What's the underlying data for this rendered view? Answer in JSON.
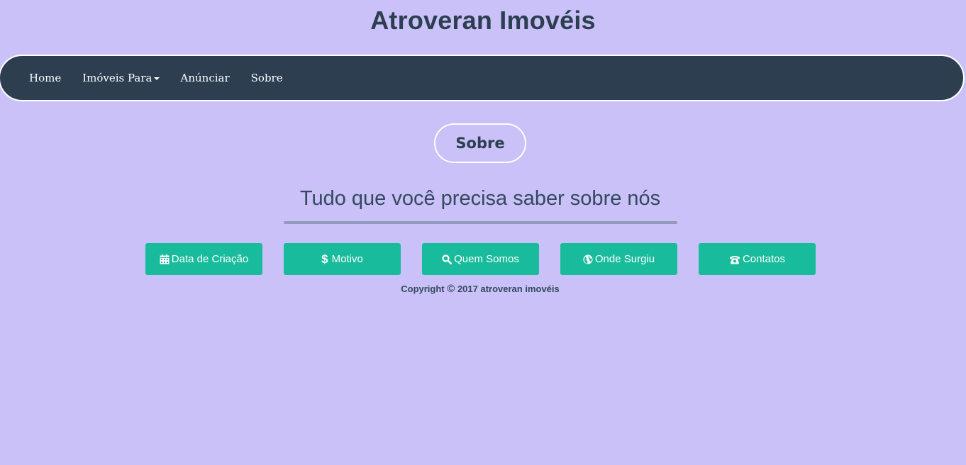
{
  "site": {
    "title": "Atroveran Imovéis"
  },
  "nav": {
    "items": [
      {
        "label": "Home"
      },
      {
        "label": "Imóveis Para"
      },
      {
        "label": "Anúnciar"
      },
      {
        "label": "Sobre"
      }
    ]
  },
  "section": {
    "title": "Sobre",
    "tagline": "Tudo que você precisa saber sobre nós"
  },
  "buttons": [
    {
      "label": "Data de Criação",
      "icon": "calendar-icon"
    },
    {
      "label": "Motivo",
      "icon": "dollar-icon"
    },
    {
      "label": "Quem Somos",
      "icon": "search-icon"
    },
    {
      "label": "Onde Surgiu",
      "icon": "globe-icon"
    },
    {
      "label": "Contatos",
      "icon": "phone-icon"
    }
  ],
  "footer": {
    "copyright_prefix": "Copyright",
    "copyright_symbol": "©",
    "copyright_suffix": "2017 atroveran imovéis"
  },
  "colors": {
    "background": "#c9c1f8",
    "navbar": "#2c3e50",
    "button": "#18bc9c",
    "text": "#2c3e50"
  }
}
